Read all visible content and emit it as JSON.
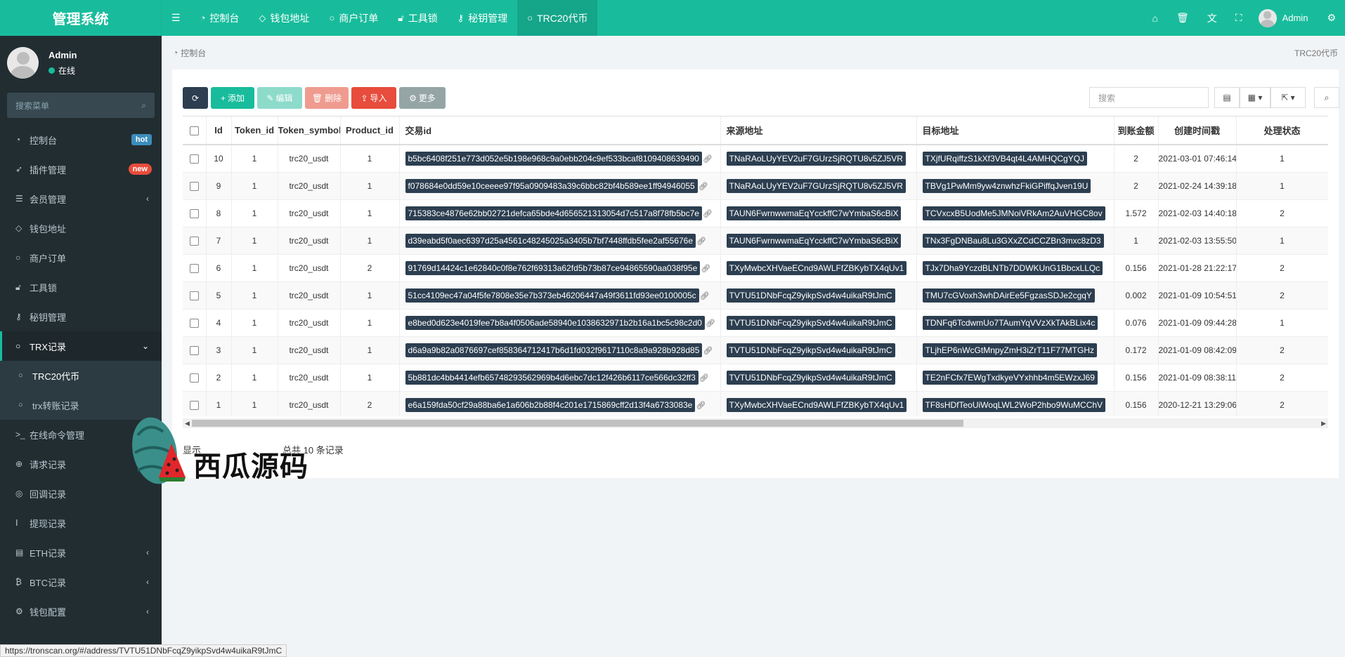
{
  "app": {
    "title": "管理系统"
  },
  "topnav": {
    "items": [
      {
        "icon": "speedometer-icon",
        "label": "控制台"
      },
      {
        "icon": "diamond-icon",
        "label": "钱包地址"
      },
      {
        "icon": "circle-icon",
        "label": "商户订单"
      },
      {
        "icon": "lock-icon",
        "label": "工具锁"
      },
      {
        "icon": "key-icon",
        "label": "秘钥管理"
      },
      {
        "icon": "circle-icon",
        "label": "TRC20代币"
      }
    ],
    "user": "Admin"
  },
  "sidebar": {
    "user": {
      "name": "Admin",
      "status": "在线"
    },
    "search_placeholder": "搜索菜单",
    "items": [
      {
        "label": "控制台",
        "badge": "hot"
      },
      {
        "label": "插件管理",
        "badge": "new"
      },
      {
        "label": "会员管理"
      },
      {
        "label": "钱包地址"
      },
      {
        "label": "商户订单"
      },
      {
        "label": "工具锁"
      },
      {
        "label": "秘钥管理"
      },
      {
        "label": "TRX记录"
      },
      {
        "label": "TRC20代币"
      },
      {
        "label": "trx转账记录"
      },
      {
        "label": "在线命令管理"
      },
      {
        "label": "请求记录"
      },
      {
        "label": "回调记录"
      },
      {
        "label": "提现记录"
      },
      {
        "label": "ETH记录"
      },
      {
        "label": "BTC记录"
      },
      {
        "label": "钱包配置"
      }
    ]
  },
  "breadcrumb": {
    "home": "控制台",
    "current": "TRC20代币"
  },
  "toolbar": {
    "add": "添加",
    "edit": "编辑",
    "delete": "删除",
    "import": "导入",
    "more": "更多",
    "search_placeholder": "搜索"
  },
  "table": {
    "headers": [
      "Id",
      "Token_id",
      "Token_symbol",
      "Product_id",
      "交易id",
      "来源地址",
      "目标地址",
      "到账金额",
      "创建时间戳",
      "处理状态"
    ],
    "rows": [
      [
        "10",
        "1",
        "trc20_usdt",
        "1",
        "b5bc6408f251e773d052e5b198e968c9a0ebb204c9ef533bcaf8109408639490",
        "TNaRAoLUyYEV2uF7GUrzSjRQTU8v5ZJ5VR",
        "TXjfURqiffzS1kXf3VB4qt4L4AMHQCgYQJ",
        "2",
        "2021-03-01 07:46:14",
        "1"
      ],
      [
        "9",
        "1",
        "trc20_usdt",
        "1",
        "f078684e0dd59e10ceeee97f95a0909483a39c6bbc82bf4b589ee1ff94946055",
        "TNaRAoLUyYEV2uF7GUrzSjRQTU8v5ZJ5VR",
        "TBVg1PwMm9yw4znwhzFkiGPiffqJven19U",
        "2",
        "2021-02-24 14:39:18",
        "1"
      ],
      [
        "8",
        "1",
        "trc20_usdt",
        "1",
        "715383ce4876e62bb02721defca65bde4d656521313054d7c517a8f78fb5bc7e",
        "TAUN6FwrnwwmaEqYcckffC7wYmbaS6cBiX",
        "TCVxcxB5UodMe5JMNoiVRkAm2AuVHGC8ov",
        "1.572",
        "2021-02-03 14:40:18",
        "2"
      ],
      [
        "7",
        "1",
        "trc20_usdt",
        "1",
        "d39eabd5f0aec6397d25a4561c48245025a3405b7bf7448ffdb5fee2af55676e",
        "TAUN6FwrnwwmaEqYcckffC7wYmbaS6cBiX",
        "TNx3FgDNBau8Lu3GXxZCdCCZBn3mxc8zD3",
        "1",
        "2021-02-03 13:55:50",
        "1"
      ],
      [
        "6",
        "1",
        "trc20_usdt",
        "2",
        "91769d14424c1e62840c0f8e762f69313a62fd5b73b87ce94865590aa038f95e",
        "TXyMwbcXHVaeECnd9AWLFfZBKybTX4qUv1",
        "TJx7Dha9YczdBLNTb7DDWKUnG1BbcxLLQc",
        "0.156",
        "2021-01-28 21:22:17",
        "2"
      ],
      [
        "5",
        "1",
        "trc20_usdt",
        "1",
        "51cc4109ec47a04f5fe7808e35e7b373eb46206447a49f3611fd93ee0100005c",
        "TVTU51DNbFcqZ9yikpSvd4w4uikaR9tJmC",
        "TMU7cGVoxh3whDAirEe5FgzasSDJe2cgqY",
        "0.002",
        "2021-01-09 10:54:51",
        "2"
      ],
      [
        "4",
        "1",
        "trc20_usdt",
        "1",
        "e8bed0d623e4019fee7b8a4f0506ade58940e1038632971b2b16a1bc5c98c2d0",
        "TVTU51DNbFcqZ9yikpSvd4w4uikaR9tJmC",
        "TDNFq6TcdwmUo7TAumYqVVzXkTAkBLix4c",
        "0.076",
        "2021-01-09 09:44:28",
        "1"
      ],
      [
        "3",
        "1",
        "trc20_usdt",
        "1",
        "d6a9a9b82a0876697cef858364712417b6d1fd032f9617110c8a9a928b928d85",
        "TVTU51DNbFcqZ9yikpSvd4w4uikaR9tJmC",
        "TLjhEP6nWcGtMnpyZmH3iZrT11F77MTGHz",
        "0.172",
        "2021-01-09 08:42:09",
        "2"
      ],
      [
        "2",
        "1",
        "trc20_usdt",
        "1",
        "5b881dc4bb4414efb65748293562969b4d6ebc7dc12f426b6117ce566dc32ff3",
        "TVTU51DNbFcqZ9yikpSvd4w4uikaR9tJmC",
        "TE2nFCfx7EWgTxdkyeVYxhhb4m5EWzxJ69",
        "0.156",
        "2021-01-09 08:38:11",
        "2"
      ],
      [
        "1",
        "1",
        "trc20_usdt",
        "2",
        "e6a159fda50cf29a88ba6e1a606b2b88f4c201e1715869cff2d13f4a6733083e",
        "TXyMwbcXHVaeECnd9AWLFfZBKybTX4qUv1",
        "TF8sHDfTeoUiWoqLWL2WoP2hbo9WuMCChV",
        "0.156",
        "2020-12-21 13:29:06",
        "2"
      ]
    ]
  },
  "pagination": {
    "prefix": "显示",
    "total": "总共 10 条记录"
  },
  "watermark": {
    "text": "西瓜源码"
  },
  "statusbar": {
    "url": "https://tronscan.org/#/address/TVTU51DNbFcqZ9yikpSvd4w4uikaR9tJmC"
  },
  "colors": {
    "primary": "#18bc9c",
    "sidebar": "#222d32",
    "dark": "#2c3e50",
    "danger": "#e74c3c"
  }
}
